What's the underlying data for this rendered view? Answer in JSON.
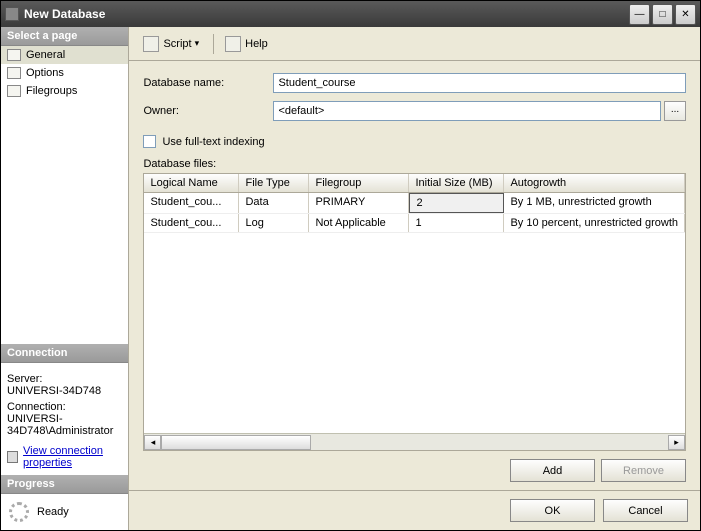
{
  "window": {
    "title": "New Database"
  },
  "sidebar": {
    "select_page": "Select a page",
    "pages": [
      {
        "label": "General",
        "selected": true
      },
      {
        "label": "Options",
        "selected": false
      },
      {
        "label": "Filegroups",
        "selected": false
      }
    ],
    "connection_hdr": "Connection",
    "server_lbl": "Server:",
    "server_val": "UNIVERSI-34D748",
    "conn_lbl": "Connection:",
    "conn_val": "UNIVERSI-34D748\\Administrator",
    "view_conn": "View connection properties",
    "progress_hdr": "Progress",
    "progress_val": "Ready"
  },
  "toolbar": {
    "script": "Script",
    "help": "Help"
  },
  "form": {
    "dbname_lbl": "Database name:",
    "dbname_val": "Student_course",
    "owner_lbl": "Owner:",
    "owner_val": "<default>",
    "browse": "...",
    "fulltext": "Use full-text indexing",
    "files_lbl": "Database files:"
  },
  "grid": {
    "headers": [
      "Logical Name",
      "File Type",
      "Filegroup",
      "Initial Size (MB)",
      "Autogrowth"
    ],
    "rows": [
      {
        "c": [
          "Student_cou...",
          "Data",
          "PRIMARY",
          "2",
          "By 1 MB, unrestricted growth"
        ]
      },
      {
        "c": [
          "Student_cou...",
          "Log",
          "Not Applicable",
          "1",
          "By 10 percent, unrestricted growth"
        ]
      }
    ]
  },
  "buttons": {
    "add": "Add",
    "remove": "Remove",
    "ok": "OK",
    "cancel": "Cancel"
  }
}
